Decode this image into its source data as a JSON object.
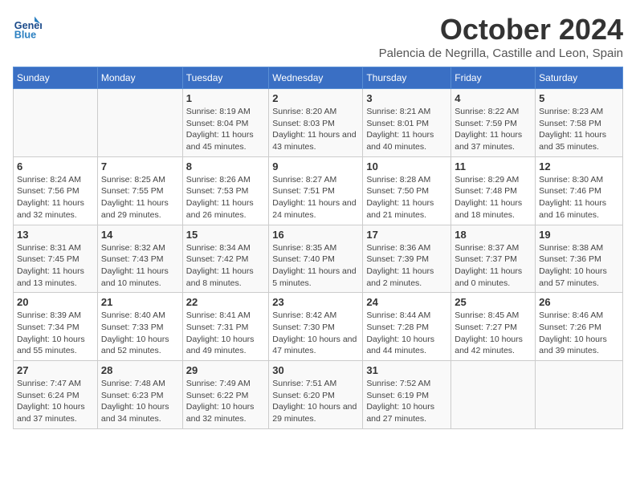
{
  "header": {
    "logo_general": "General",
    "logo_blue": "Blue",
    "main_title": "October 2024",
    "subtitle": "Palencia de Negrilla, Castille and Leon, Spain"
  },
  "calendar": {
    "days_of_week": [
      "Sunday",
      "Monday",
      "Tuesday",
      "Wednesday",
      "Thursday",
      "Friday",
      "Saturday"
    ],
    "weeks": [
      [
        {
          "day": "",
          "info": ""
        },
        {
          "day": "",
          "info": ""
        },
        {
          "day": "1",
          "info": "Sunrise: 8:19 AM\nSunset: 8:04 PM\nDaylight: 11 hours and 45 minutes."
        },
        {
          "day": "2",
          "info": "Sunrise: 8:20 AM\nSunset: 8:03 PM\nDaylight: 11 hours and 43 minutes."
        },
        {
          "day": "3",
          "info": "Sunrise: 8:21 AM\nSunset: 8:01 PM\nDaylight: 11 hours and 40 minutes."
        },
        {
          "day": "4",
          "info": "Sunrise: 8:22 AM\nSunset: 7:59 PM\nDaylight: 11 hours and 37 minutes."
        },
        {
          "day": "5",
          "info": "Sunrise: 8:23 AM\nSunset: 7:58 PM\nDaylight: 11 hours and 35 minutes."
        }
      ],
      [
        {
          "day": "6",
          "info": "Sunrise: 8:24 AM\nSunset: 7:56 PM\nDaylight: 11 hours and 32 minutes."
        },
        {
          "day": "7",
          "info": "Sunrise: 8:25 AM\nSunset: 7:55 PM\nDaylight: 11 hours and 29 minutes."
        },
        {
          "day": "8",
          "info": "Sunrise: 8:26 AM\nSunset: 7:53 PM\nDaylight: 11 hours and 26 minutes."
        },
        {
          "day": "9",
          "info": "Sunrise: 8:27 AM\nSunset: 7:51 PM\nDaylight: 11 hours and 24 minutes."
        },
        {
          "day": "10",
          "info": "Sunrise: 8:28 AM\nSunset: 7:50 PM\nDaylight: 11 hours and 21 minutes."
        },
        {
          "day": "11",
          "info": "Sunrise: 8:29 AM\nSunset: 7:48 PM\nDaylight: 11 hours and 18 minutes."
        },
        {
          "day": "12",
          "info": "Sunrise: 8:30 AM\nSunset: 7:46 PM\nDaylight: 11 hours and 16 minutes."
        }
      ],
      [
        {
          "day": "13",
          "info": "Sunrise: 8:31 AM\nSunset: 7:45 PM\nDaylight: 11 hours and 13 minutes."
        },
        {
          "day": "14",
          "info": "Sunrise: 8:32 AM\nSunset: 7:43 PM\nDaylight: 11 hours and 10 minutes."
        },
        {
          "day": "15",
          "info": "Sunrise: 8:34 AM\nSunset: 7:42 PM\nDaylight: 11 hours and 8 minutes."
        },
        {
          "day": "16",
          "info": "Sunrise: 8:35 AM\nSunset: 7:40 PM\nDaylight: 11 hours and 5 minutes."
        },
        {
          "day": "17",
          "info": "Sunrise: 8:36 AM\nSunset: 7:39 PM\nDaylight: 11 hours and 2 minutes."
        },
        {
          "day": "18",
          "info": "Sunrise: 8:37 AM\nSunset: 7:37 PM\nDaylight: 11 hours and 0 minutes."
        },
        {
          "day": "19",
          "info": "Sunrise: 8:38 AM\nSunset: 7:36 PM\nDaylight: 10 hours and 57 minutes."
        }
      ],
      [
        {
          "day": "20",
          "info": "Sunrise: 8:39 AM\nSunset: 7:34 PM\nDaylight: 10 hours and 55 minutes."
        },
        {
          "day": "21",
          "info": "Sunrise: 8:40 AM\nSunset: 7:33 PM\nDaylight: 10 hours and 52 minutes."
        },
        {
          "day": "22",
          "info": "Sunrise: 8:41 AM\nSunset: 7:31 PM\nDaylight: 10 hours and 49 minutes."
        },
        {
          "day": "23",
          "info": "Sunrise: 8:42 AM\nSunset: 7:30 PM\nDaylight: 10 hours and 47 minutes."
        },
        {
          "day": "24",
          "info": "Sunrise: 8:44 AM\nSunset: 7:28 PM\nDaylight: 10 hours and 44 minutes."
        },
        {
          "day": "25",
          "info": "Sunrise: 8:45 AM\nSunset: 7:27 PM\nDaylight: 10 hours and 42 minutes."
        },
        {
          "day": "26",
          "info": "Sunrise: 8:46 AM\nSunset: 7:26 PM\nDaylight: 10 hours and 39 minutes."
        }
      ],
      [
        {
          "day": "27",
          "info": "Sunrise: 7:47 AM\nSunset: 6:24 PM\nDaylight: 10 hours and 37 minutes."
        },
        {
          "day": "28",
          "info": "Sunrise: 7:48 AM\nSunset: 6:23 PM\nDaylight: 10 hours and 34 minutes."
        },
        {
          "day": "29",
          "info": "Sunrise: 7:49 AM\nSunset: 6:22 PM\nDaylight: 10 hours and 32 minutes."
        },
        {
          "day": "30",
          "info": "Sunrise: 7:51 AM\nSunset: 6:20 PM\nDaylight: 10 hours and 29 minutes."
        },
        {
          "day": "31",
          "info": "Sunrise: 7:52 AM\nSunset: 6:19 PM\nDaylight: 10 hours and 27 minutes."
        },
        {
          "day": "",
          "info": ""
        },
        {
          "day": "",
          "info": ""
        }
      ]
    ]
  }
}
